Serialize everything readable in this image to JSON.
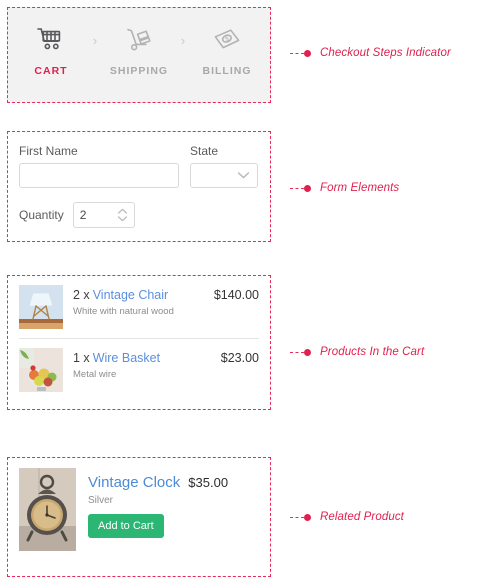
{
  "checkout_steps": {
    "panel_bg": "#f2f2f2",
    "active_color": "#e0214f",
    "inactive_color": "#a8a8a8",
    "separator": "›",
    "steps": [
      {
        "label": "CART",
        "icon": "shopping-cart-icon",
        "active": true
      },
      {
        "label": "SHIPPING",
        "icon": "hand-truck-icon",
        "active": false
      },
      {
        "label": "BILLING",
        "icon": "banknote-icon",
        "active": false
      }
    ]
  },
  "form": {
    "first_name": {
      "label": "First Name",
      "value": "",
      "placeholder": ""
    },
    "state": {
      "label": "State",
      "value": "",
      "chevron": "chevron-down-icon"
    },
    "quantity": {
      "label": "Quantity",
      "value": "2"
    }
  },
  "cart": {
    "items": [
      {
        "qty": "2 x",
        "name": "Vintage Chair",
        "description": "White with natural wood",
        "price": "$140.00",
        "thumb": "vintage-chair-thumbnail"
      },
      {
        "qty": "1 x",
        "name": "Wire Basket",
        "description": "Metal wire",
        "price": "$23.00",
        "thumb": "wire-basket-thumbnail"
      }
    ]
  },
  "related": {
    "name": "Vintage Clock",
    "price": "$35.00",
    "description": "Silver",
    "button_label": "Add to Cart",
    "button_color": "#2bb673",
    "thumb": "vintage-clock-thumbnail"
  },
  "annotations": {
    "color": "#e0214f",
    "items": [
      {
        "label": "Checkout Steps Indicator"
      },
      {
        "label": "Form Elements"
      },
      {
        "label": "Products In the Cart"
      },
      {
        "label": "Related Product"
      }
    ]
  }
}
